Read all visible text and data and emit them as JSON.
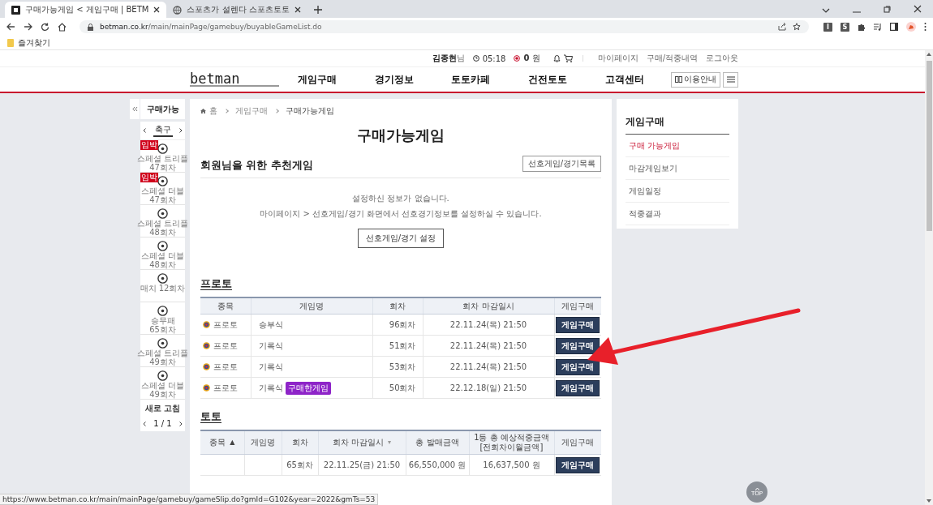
{
  "browser": {
    "tabs": [
      {
        "title": "구매가능게임 < 게임구매 | BETM",
        "selected": true
      },
      {
        "title": "스포츠가 설렌다 스포츠토토",
        "selected": false
      }
    ],
    "url_host": "betman.co.kr",
    "url_path": "/main/mainPage/gamebuy/buyableGameList.do",
    "extensions": [
      "I",
      "S"
    ],
    "bookmarks": [
      "즐겨찾기"
    ]
  },
  "util_bar": {
    "user": "김종현",
    "user_suffix": "님",
    "timer": "05:18",
    "points": "0",
    "points_unit": "원",
    "links": [
      "마이페이지",
      "구매/적중내역",
      "로그아웃"
    ]
  },
  "header": {
    "logo": "betman",
    "nav": [
      "게임구매",
      "경기정보",
      "토토카페",
      "건전토토",
      "고객센터"
    ],
    "guide_button": "이용안내"
  },
  "sidebar": {
    "title": "구매가능",
    "sport": "축구",
    "items": [
      {
        "name": "스페셜 트리플",
        "round": "47회차",
        "badge": "임박"
      },
      {
        "name": "스페셜 더블",
        "round": "47회차",
        "badge": "임박"
      },
      {
        "name": "스페셜 트리플",
        "round": "48회차"
      },
      {
        "name": "스페셜 더블",
        "round": "48회차"
      },
      {
        "name": "매치 12회차"
      },
      {
        "name": "승무패",
        "round": "65회차"
      },
      {
        "name": "스페셜 트리플",
        "round": "49회차"
      },
      {
        "name": "스페셜 더블",
        "round": "49회차"
      }
    ],
    "refresh": "새로 고침",
    "pager": "1 / 1"
  },
  "breadcrumb": [
    "홈",
    "게임구매",
    "구매가능게임"
  ],
  "page_title": "구매가능게임",
  "recommend": {
    "heading": "회원님을 위한 추천게임",
    "list_button": "선호게임/경기목록",
    "messages": [
      "설정하신 정보가 없습니다.",
      "마이페이지 > 선호게임/경기 화면에서 선호경기정보를 설정하실 수 있습니다."
    ],
    "setup_button": "선호게임/경기 설정"
  },
  "proto": {
    "heading": "프로토",
    "columns": [
      "종목",
      "게임명",
      "회차",
      "회차 마감일시",
      "게임구매"
    ],
    "rows": [
      {
        "sport": "프로토",
        "game": "승부식",
        "round": "96회차",
        "deadline": "22.11.24(목) 21:50",
        "button": "게임구매"
      },
      {
        "sport": "프로토",
        "game": "기록식",
        "round": "51회차",
        "deadline": "22.11.24(목) 21:50",
        "button": "게임구매"
      },
      {
        "sport": "프로토",
        "game": "기록식",
        "round": "53회차",
        "deadline": "22.11.24(목) 21:50",
        "button": "게임구매"
      },
      {
        "sport": "프로토",
        "game": "기록식",
        "tag": "구매한게임",
        "round": "50회차",
        "deadline": "22.12.18(일) 21:50",
        "button": "게임구매"
      }
    ]
  },
  "toto": {
    "heading": "토토",
    "columns": [
      {
        "label": "종목",
        "sort_mark": "▲"
      },
      {
        "label": "게임명"
      },
      {
        "label": "회차"
      },
      {
        "label": "회차 마감일시",
        "sort_mark": "▾"
      },
      {
        "label": "총 발매금액"
      },
      {
        "label": "1등 총 예상적중금액",
        "sub": "[전회차이월금액]"
      },
      {
        "label": "게임구매"
      }
    ],
    "rows": [
      {
        "round": "65회차",
        "deadline": "22.11.25(금) 21:50",
        "sales": "66,550,000 원",
        "expected": "16,637,500 원",
        "button": "게임구매"
      }
    ]
  },
  "side_menu": {
    "title": "게임구매",
    "items": [
      {
        "label": "구매 가능게임",
        "selected": true
      },
      {
        "label": "마감게임보기",
        "selected": false
      },
      {
        "label": "게임일정",
        "selected": false
      },
      {
        "label": "적중결과",
        "selected": false
      }
    ]
  },
  "top_button": "TOP",
  "status_url": "https://www.betman.co.kr/main/mainPage/gamebuy/gameSlip.do?gmId=G102&year=2022&gmTs=53"
}
